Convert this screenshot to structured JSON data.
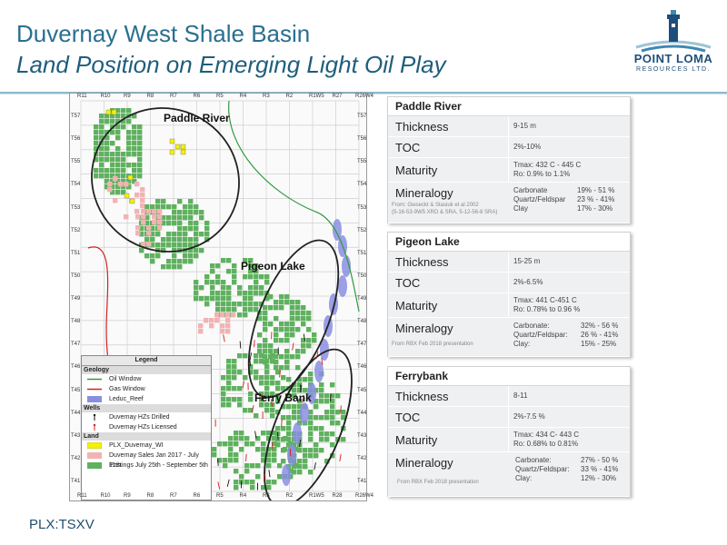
{
  "header": {
    "title_line1": "Duvernay West Shale Basin",
    "title_line2": "Land Position on Emerging Light Oil Play"
  },
  "logo": {
    "name": "POINT LOMA",
    "sub": "RESOURCES LTD.",
    "icon": "lighthouse-icon",
    "color": "#1e4e7a"
  },
  "footer": {
    "ticker": "PLX:TSXV"
  },
  "map": {
    "ranges_top": [
      "R11",
      "R10",
      "R9",
      "R8",
      "R7",
      "R6",
      "R5",
      "R4",
      "R3",
      "R2",
      "R1W5",
      "R27",
      "R26W4"
    ],
    "ranges_bottom": [
      "R11",
      "R10",
      "R9",
      "R8",
      "R7",
      "R6",
      "R5",
      "R4",
      "R3",
      "R2",
      "R1W5",
      "R28",
      "R26W4"
    ],
    "townships_left": [
      "T57",
      "T56",
      "T55",
      "T54",
      "T53",
      "T52",
      "T51",
      "T50",
      "T49",
      "T48",
      "T47",
      "T46",
      "T45",
      "T44",
      "T43",
      "T42",
      "T41"
    ],
    "townships_right": [
      "T57",
      "T56",
      "T55",
      "T54",
      "T53",
      "T52",
      "T51",
      "T50",
      "T49",
      "T48",
      "T47",
      "T46",
      "T45",
      "T44",
      "T43",
      "T42",
      "T41"
    ],
    "areas": [
      "Paddle River",
      "Pigeon Lake",
      "Ferry Bank"
    ],
    "colors": {
      "green": "#5fb15f",
      "pink": "#f2b3b3",
      "blue": "#8a8ee0",
      "yellow": "#f4f200",
      "red": "#d32020",
      "oil": "#2e9b3e"
    }
  },
  "legend": {
    "title": "Legend",
    "geology_label": "Geology",
    "geology": [
      "Oil Window",
      "Gas Window",
      "Leduc_Reef"
    ],
    "wells_label": "Wells",
    "wells": [
      "Duvernay HZs Drilled",
      "Duvernay HZs Licensed"
    ],
    "land_label": "Land",
    "land": [
      "PLX_Duvernay_WI",
      "Duvernay Sales Jan 2017 - July 11th",
      "Postings July 25th - September 5th"
    ]
  },
  "cards": [
    {
      "name": "Paddle River",
      "thickness_label": "Thickness",
      "thickness": "9-15 m",
      "toc_label": "TOC",
      "toc": "2%-10%",
      "maturity_label": "Maturity",
      "maturity": [
        "Tmax: 432 C - 445 C",
        "Ro: 0.9% to 1.1%"
      ],
      "mineralogy_label": "Mineralogy",
      "mineralogy": [
        [
          "Carbonate",
          "19% - 51 %"
        ],
        [
          "Quartz/Feldspar",
          "23 % - 41%"
        ],
        [
          "Clay",
          "17% - 30%"
        ]
      ],
      "source": [
        "From: Gieseckt & Stasiuk et al 2002",
        "(5-16-53-9W5 XRD & SRA, 5-12-56-8 SRA)"
      ]
    },
    {
      "name": "Pigeon Lake",
      "thickness_label": "Thickness",
      "thickness": "15-25 m",
      "toc_label": "TOC",
      "toc": "2%-6.5%",
      "maturity_label": "Maturity",
      "maturity": [
        "Tmax: 441 C-451 C",
        "Ro: 0.78% to 0.96 %"
      ],
      "mineralogy_label": "Mineralogy",
      "mineralogy": [
        [
          "Carbonate:",
          "32% - 56 %"
        ],
        [
          "Quartz/Feldspar:",
          "26 % - 41%"
        ],
        [
          "Clay:",
          "15% - 25%"
        ]
      ],
      "source": [
        "From RBX Feb 2018 presentation"
      ]
    },
    {
      "name": "Ferrybank",
      "thickness_label": "Thickness",
      "thickness": "8-11",
      "toc_label": "TOC",
      "toc": "2%-7.5 %",
      "maturity_label": "Maturity",
      "maturity": [
        "Tmax: 434 C- 443 C",
        "Ro: 0.68% to 0.81%"
      ],
      "mineralogy_label": "Mineralogy",
      "mineralogy": [
        [
          "Carbonate:",
          "27% - 50 %"
        ],
        [
          "Quartz/Feldspar:",
          "33 % - 41%"
        ],
        [
          "Clay:",
          "12% - 30%"
        ]
      ],
      "source": [
        "From RBX Feb 2018 presentation"
      ]
    }
  ]
}
